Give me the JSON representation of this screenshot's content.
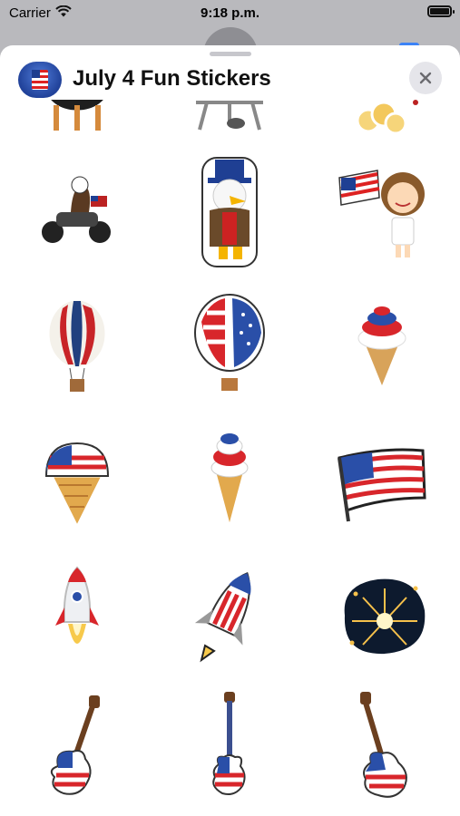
{
  "status_bar": {
    "carrier": "Carrier",
    "time": "9:18 p.m.",
    "icons": [
      "wifi-icon",
      "battery-icon"
    ]
  },
  "sheet": {
    "title": "July 4 Fun Stickers",
    "app_icon": "uncle-sam-app-icon",
    "close_icon": "close-icon"
  },
  "stickers": [
    "grill-sticker",
    "bbq-rack-sticker",
    "popcorn-sticker",
    "eagle-motorcycle-sticker",
    "eagle-uncle-sam-hat-sticker",
    "girl-waving-flag-sticker",
    "striped-hot-air-balloon-sticker",
    "flag-hot-air-balloon-sticker",
    "swirl-ice-cream-cone-sticker",
    "flag-ice-cream-scoop-sticker",
    "patriotic-popsicle-cone-sticker",
    "waving-usa-flag-sticker",
    "white-rocket-sticker",
    "flag-rocket-sticker",
    "fireworks-burst-sticker",
    "flag-guitar-sticker-1",
    "flag-guitar-sticker-2",
    "flag-electric-guitar-sticker"
  ],
  "colors": {
    "red": "#d8262b",
    "blue": "#1f3f93",
    "white": "#ffffff",
    "sheet_background": "#ffffff",
    "backdrop": "#b9b9bd"
  }
}
